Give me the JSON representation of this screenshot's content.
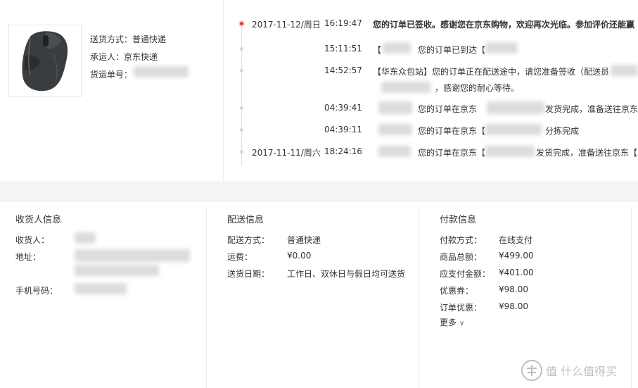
{
  "shipping": {
    "method_label": "送货方式：普通快递",
    "carrier_label": "承运人：京东快递",
    "tracking_label": "货运单号："
  },
  "timeline": [
    {
      "date": "2017-11-12/周日",
      "time": "16:19:47",
      "text": "您的订单已签收。感谢您在京东购物，欢迎再次光临。参加评价还能赢",
      "strong": true
    },
    {
      "date": "",
      "time": "15:11:51",
      "text": "您的订单已到达【",
      "text_pre": "【"
    },
    {
      "date": "",
      "time": "14:52:57",
      "text": "【华东众包站】您的订单正在配送途中，请您准备签收（配送员",
      "text2": "，感谢您的耐心等待。"
    },
    {
      "date": "",
      "time": "04:39:41",
      "text": "您的订单在京东",
      "text_after": "发货完成，准备送往京东"
    },
    {
      "date": "",
      "time": "04:39:11",
      "text": "您的订单在京东【",
      "text_after": "分拣完成"
    },
    {
      "date": "2017-11-11/周六",
      "time": "18:24:16",
      "text": "您的订单在京东【",
      "text_after": "发货完成，准备送往京东【"
    }
  ],
  "receiver": {
    "title": "收货人信息",
    "name_label": "收货人：",
    "address_label": "地址：",
    "phone_label": "手机号码："
  },
  "delivery": {
    "title": "配送信息",
    "method_label": "配送方式：",
    "method_value": "普通快递",
    "fee_label": "运费：",
    "fee_value": "¥0.00",
    "date_label": "送货日期：",
    "date_value": "工作日、双休日与假日均可送货"
  },
  "payment": {
    "title": "付款信息",
    "method_label": "付款方式：",
    "method_value": "在线支付",
    "total_label": "商品总额：",
    "total_value": "¥499.00",
    "payable_label": "应支付金额：",
    "payable_value": "¥401.00",
    "coupon_label": "优惠券：",
    "coupon_value": "¥98.00",
    "order_discount_label": "订单优惠：",
    "order_discount_value": "¥98.00",
    "more_label": "更多"
  },
  "watermark": {
    "text": "值 什么值得买"
  }
}
